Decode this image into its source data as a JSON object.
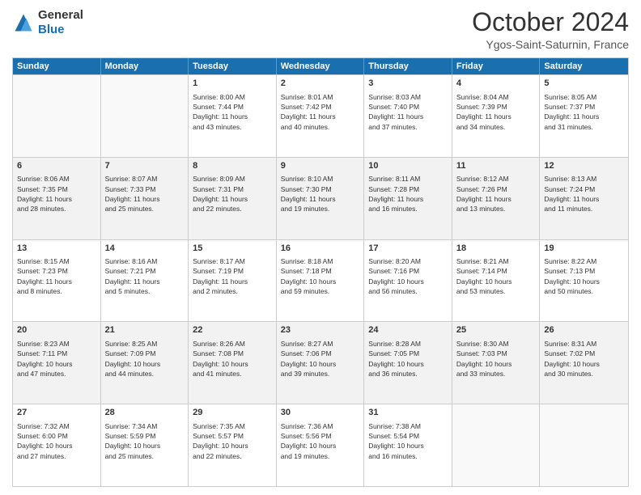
{
  "header": {
    "logo_general": "General",
    "logo_blue": "Blue",
    "title": "October 2024",
    "subtitle": "Ygos-Saint-Saturnin, France"
  },
  "days_of_week": [
    "Sunday",
    "Monday",
    "Tuesday",
    "Wednesday",
    "Thursday",
    "Friday",
    "Saturday"
  ],
  "weeks": [
    [
      {
        "day": "",
        "empty": true
      },
      {
        "day": "",
        "empty": true
      },
      {
        "day": "1",
        "lines": [
          "Sunrise: 8:00 AM",
          "Sunset: 7:44 PM",
          "Daylight: 11 hours",
          "and 43 minutes."
        ]
      },
      {
        "day": "2",
        "lines": [
          "Sunrise: 8:01 AM",
          "Sunset: 7:42 PM",
          "Daylight: 11 hours",
          "and 40 minutes."
        ]
      },
      {
        "day": "3",
        "lines": [
          "Sunrise: 8:03 AM",
          "Sunset: 7:40 PM",
          "Daylight: 11 hours",
          "and 37 minutes."
        ]
      },
      {
        "day": "4",
        "lines": [
          "Sunrise: 8:04 AM",
          "Sunset: 7:39 PM",
          "Daylight: 11 hours",
          "and 34 minutes."
        ]
      },
      {
        "day": "5",
        "lines": [
          "Sunrise: 8:05 AM",
          "Sunset: 7:37 PM",
          "Daylight: 11 hours",
          "and 31 minutes."
        ]
      }
    ],
    [
      {
        "day": "6",
        "lines": [
          "Sunrise: 8:06 AM",
          "Sunset: 7:35 PM",
          "Daylight: 11 hours",
          "and 28 minutes."
        ]
      },
      {
        "day": "7",
        "lines": [
          "Sunrise: 8:07 AM",
          "Sunset: 7:33 PM",
          "Daylight: 11 hours",
          "and 25 minutes."
        ]
      },
      {
        "day": "8",
        "lines": [
          "Sunrise: 8:09 AM",
          "Sunset: 7:31 PM",
          "Daylight: 11 hours",
          "and 22 minutes."
        ]
      },
      {
        "day": "9",
        "lines": [
          "Sunrise: 8:10 AM",
          "Sunset: 7:30 PM",
          "Daylight: 11 hours",
          "and 19 minutes."
        ]
      },
      {
        "day": "10",
        "lines": [
          "Sunrise: 8:11 AM",
          "Sunset: 7:28 PM",
          "Daylight: 11 hours",
          "and 16 minutes."
        ]
      },
      {
        "day": "11",
        "lines": [
          "Sunrise: 8:12 AM",
          "Sunset: 7:26 PM",
          "Daylight: 11 hours",
          "and 13 minutes."
        ]
      },
      {
        "day": "12",
        "lines": [
          "Sunrise: 8:13 AM",
          "Sunset: 7:24 PM",
          "Daylight: 11 hours",
          "and 11 minutes."
        ]
      }
    ],
    [
      {
        "day": "13",
        "lines": [
          "Sunrise: 8:15 AM",
          "Sunset: 7:23 PM",
          "Daylight: 11 hours",
          "and 8 minutes."
        ]
      },
      {
        "day": "14",
        "lines": [
          "Sunrise: 8:16 AM",
          "Sunset: 7:21 PM",
          "Daylight: 11 hours",
          "and 5 minutes."
        ]
      },
      {
        "day": "15",
        "lines": [
          "Sunrise: 8:17 AM",
          "Sunset: 7:19 PM",
          "Daylight: 11 hours",
          "and 2 minutes."
        ]
      },
      {
        "day": "16",
        "lines": [
          "Sunrise: 8:18 AM",
          "Sunset: 7:18 PM",
          "Daylight: 10 hours",
          "and 59 minutes."
        ]
      },
      {
        "day": "17",
        "lines": [
          "Sunrise: 8:20 AM",
          "Sunset: 7:16 PM",
          "Daylight: 10 hours",
          "and 56 minutes."
        ]
      },
      {
        "day": "18",
        "lines": [
          "Sunrise: 8:21 AM",
          "Sunset: 7:14 PM",
          "Daylight: 10 hours",
          "and 53 minutes."
        ]
      },
      {
        "day": "19",
        "lines": [
          "Sunrise: 8:22 AM",
          "Sunset: 7:13 PM",
          "Daylight: 10 hours",
          "and 50 minutes."
        ]
      }
    ],
    [
      {
        "day": "20",
        "lines": [
          "Sunrise: 8:23 AM",
          "Sunset: 7:11 PM",
          "Daylight: 10 hours",
          "and 47 minutes."
        ]
      },
      {
        "day": "21",
        "lines": [
          "Sunrise: 8:25 AM",
          "Sunset: 7:09 PM",
          "Daylight: 10 hours",
          "and 44 minutes."
        ]
      },
      {
        "day": "22",
        "lines": [
          "Sunrise: 8:26 AM",
          "Sunset: 7:08 PM",
          "Daylight: 10 hours",
          "and 41 minutes."
        ]
      },
      {
        "day": "23",
        "lines": [
          "Sunrise: 8:27 AM",
          "Sunset: 7:06 PM",
          "Daylight: 10 hours",
          "and 39 minutes."
        ]
      },
      {
        "day": "24",
        "lines": [
          "Sunrise: 8:28 AM",
          "Sunset: 7:05 PM",
          "Daylight: 10 hours",
          "and 36 minutes."
        ]
      },
      {
        "day": "25",
        "lines": [
          "Sunrise: 8:30 AM",
          "Sunset: 7:03 PM",
          "Daylight: 10 hours",
          "and 33 minutes."
        ]
      },
      {
        "day": "26",
        "lines": [
          "Sunrise: 8:31 AM",
          "Sunset: 7:02 PM",
          "Daylight: 10 hours",
          "and 30 minutes."
        ]
      }
    ],
    [
      {
        "day": "27",
        "lines": [
          "Sunrise: 7:32 AM",
          "Sunset: 6:00 PM",
          "Daylight: 10 hours",
          "and 27 minutes."
        ]
      },
      {
        "day": "28",
        "lines": [
          "Sunrise: 7:34 AM",
          "Sunset: 5:59 PM",
          "Daylight: 10 hours",
          "and 25 minutes."
        ]
      },
      {
        "day": "29",
        "lines": [
          "Sunrise: 7:35 AM",
          "Sunset: 5:57 PM",
          "Daylight: 10 hours",
          "and 22 minutes."
        ]
      },
      {
        "day": "30",
        "lines": [
          "Sunrise: 7:36 AM",
          "Sunset: 5:56 PM",
          "Daylight: 10 hours",
          "and 19 minutes."
        ]
      },
      {
        "day": "31",
        "lines": [
          "Sunrise: 7:38 AM",
          "Sunset: 5:54 PM",
          "Daylight: 10 hours",
          "and 16 minutes."
        ]
      },
      {
        "day": "",
        "empty": true
      },
      {
        "day": "",
        "empty": true
      }
    ]
  ]
}
